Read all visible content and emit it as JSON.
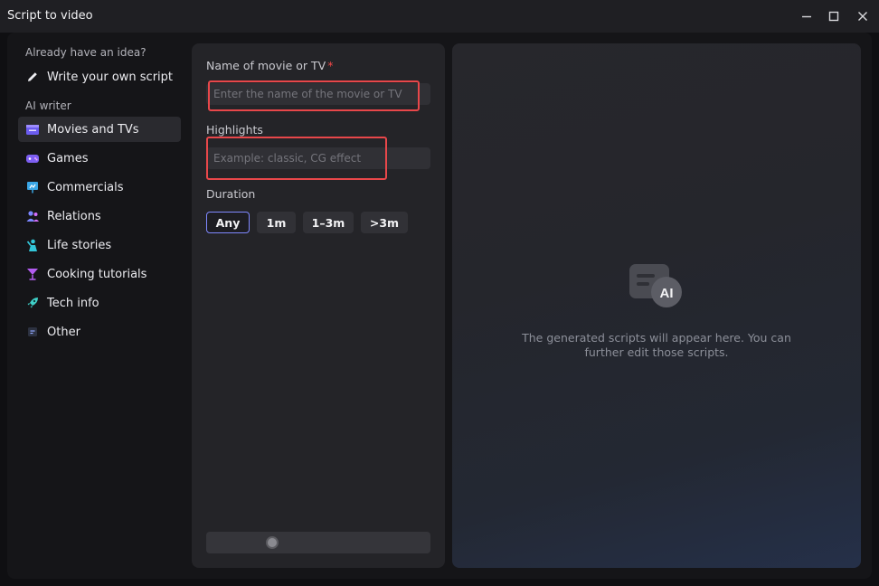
{
  "window": {
    "title": "Script to video",
    "controls": [
      "minimize-icon",
      "maximize-icon",
      "close-icon"
    ]
  },
  "sidebar": {
    "idea_heading": "Already have an idea?",
    "write_own": {
      "label": "Write your own script",
      "icon": "pencil-icon"
    },
    "ai_heading": "AI writer",
    "items": [
      {
        "label": "Movies and TVs",
        "icon": "clapperboard-icon",
        "active": true
      },
      {
        "label": "Games",
        "icon": "gamepad-icon"
      },
      {
        "label": "Commercials",
        "icon": "presentation-icon"
      },
      {
        "label": "Relations",
        "icon": "people-icon"
      },
      {
        "label": "Life stories",
        "icon": "person-waving-icon"
      },
      {
        "label": "Cooking tutorials",
        "icon": "cocktail-glass-icon"
      },
      {
        "label": "Tech info",
        "icon": "rocket-icon"
      },
      {
        "label": "Other",
        "icon": "note-icon"
      }
    ]
  },
  "form": {
    "name_label": "Name of movie or TV",
    "required_mark": "*",
    "name_placeholder": "Enter the name of the movie or TV",
    "name_value": "",
    "highlights_label": "Highlights",
    "highlights_placeholder": "Example: classic, CG effect",
    "highlights_value": "",
    "duration_label": "Duration",
    "durations": [
      {
        "label": "Any",
        "selected": true
      },
      {
        "label": "1m"
      },
      {
        "label": "1–3m"
      },
      {
        "label": ">3m"
      }
    ]
  },
  "preview": {
    "icon": "ai-document-icon",
    "message": "The generated scripts will appear here. You can further edit those scripts."
  },
  "colors": {
    "highlight_box": "#e8474a",
    "selected_border": "#7f88ff",
    "required": "#f04848"
  }
}
